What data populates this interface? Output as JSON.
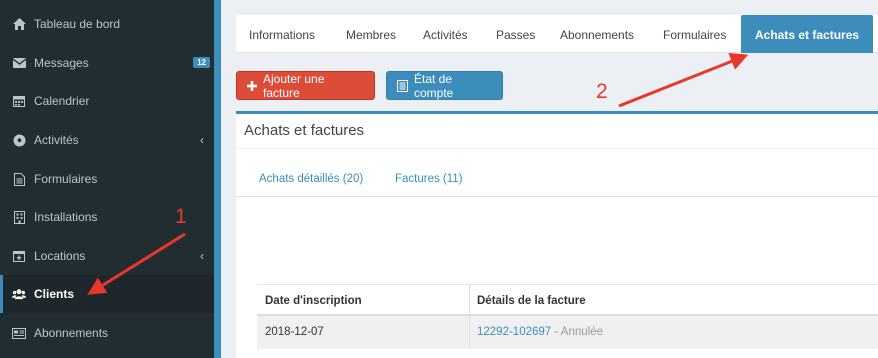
{
  "sidebar": {
    "items": [
      {
        "label": "Tableau de bord",
        "icon": "home-icon"
      },
      {
        "label": "Messages",
        "icon": "envelope-icon",
        "badge": "12"
      },
      {
        "label": "Calendrier",
        "icon": "calendar-icon"
      },
      {
        "label": "Activités",
        "icon": "soccer-ball-icon",
        "has_children": true
      },
      {
        "label": "Formulaires",
        "icon": "document-icon"
      },
      {
        "label": "Installations",
        "icon": "building-icon"
      },
      {
        "label": "Locations",
        "icon": "calendar-plus-icon",
        "has_children": true
      },
      {
        "label": "Clients",
        "icon": "users-icon",
        "active": true
      },
      {
        "label": "Abonnements",
        "icon": "newspaper-icon"
      }
    ]
  },
  "tabs": [
    {
      "label": "Informations"
    },
    {
      "label": "Membres"
    },
    {
      "label": "Activités"
    },
    {
      "label": "Passes"
    },
    {
      "label": "Abonnements"
    },
    {
      "label": "Formulaires"
    },
    {
      "label": "Achats et factures",
      "active": true
    }
  ],
  "actions": {
    "add_invoice": "Ajouter une facture",
    "account_statement": "État de compte"
  },
  "panel": {
    "title": "Achats et factures",
    "subtabs": [
      "Achats détaillés (20)",
      "Factures (11)"
    ]
  },
  "table": {
    "columns": [
      "Date d'inscription",
      "Détails de la facture"
    ],
    "rows": [
      {
        "date": "2018-12-07",
        "invoice": "12292-102697",
        "separator": " - ",
        "status": "Annulée"
      }
    ]
  },
  "annotations": {
    "one": "1",
    "two": "2"
  },
  "colors": {
    "sidebar": "#222d32",
    "accent": "#3c8dbc",
    "danger": "#dd4b39",
    "annotation": "#e8382a"
  }
}
